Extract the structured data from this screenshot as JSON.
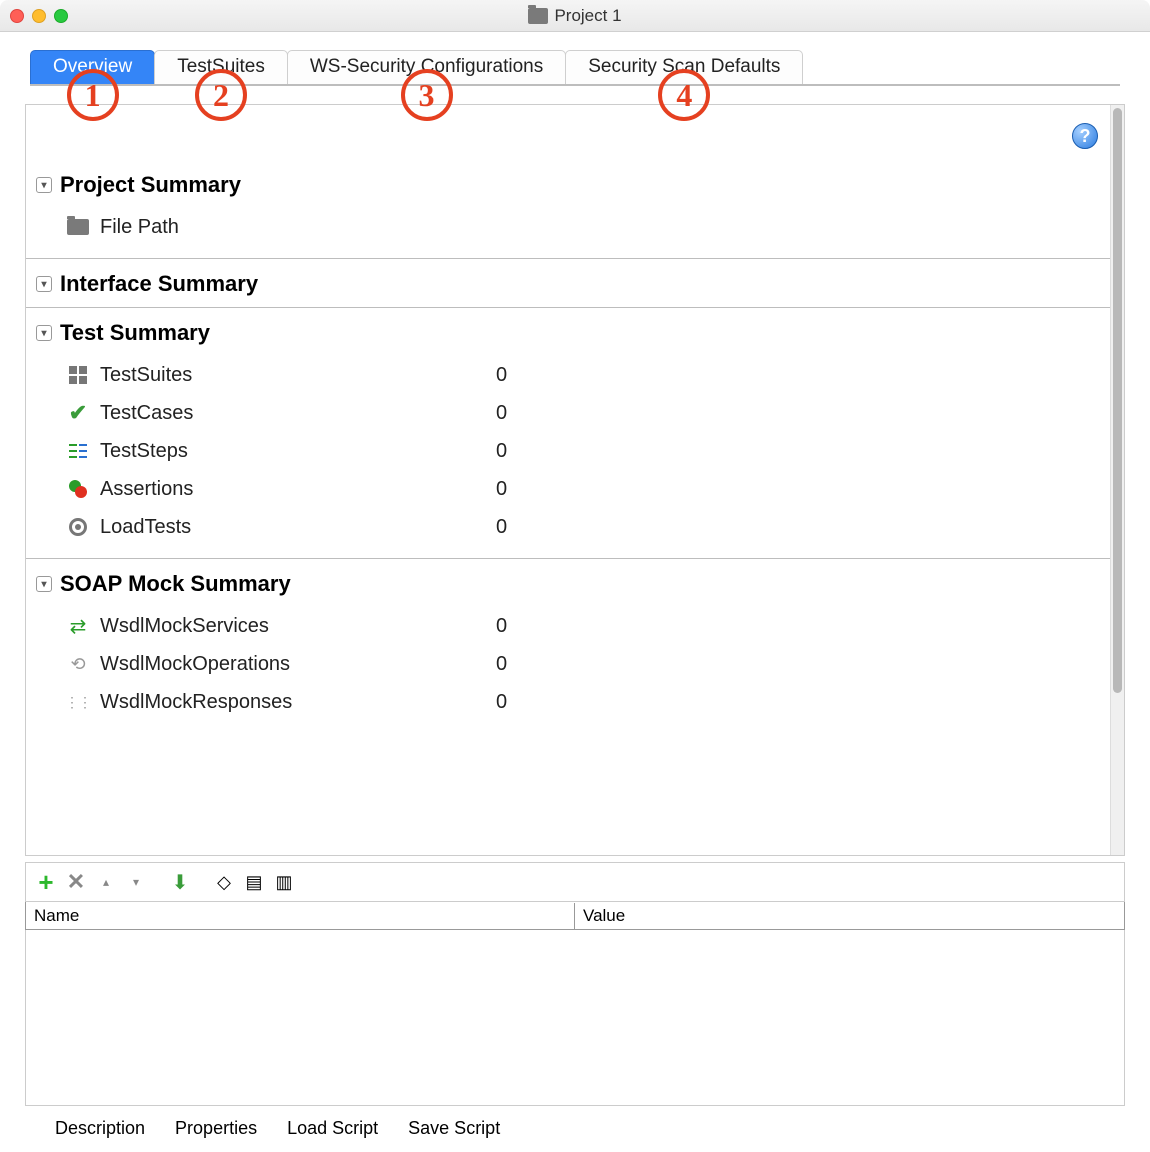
{
  "window": {
    "title": "Project 1"
  },
  "tabs": [
    {
      "label": "Overview",
      "active": true,
      "callout": "1"
    },
    {
      "label": "TestSuites",
      "active": false,
      "callout": "2"
    },
    {
      "label": "WS-Security Configurations",
      "active": false,
      "callout": "3"
    },
    {
      "label": "Security Scan Defaults",
      "active": false,
      "callout": "4"
    }
  ],
  "sections": {
    "project": {
      "title": "Project Summary",
      "items": [
        {
          "icon": "folder",
          "label": "File Path"
        }
      ]
    },
    "interface": {
      "title": "Interface Summary",
      "items": []
    },
    "test": {
      "title": "Test Summary",
      "items": [
        {
          "icon": "grid",
          "label": "TestSuites",
          "value": "0"
        },
        {
          "icon": "check",
          "label": "TestCases",
          "value": "0"
        },
        {
          "icon": "steps",
          "label": "TestSteps",
          "value": "0"
        },
        {
          "icon": "assert",
          "label": "Assertions",
          "value": "0"
        },
        {
          "icon": "load",
          "label": "LoadTests",
          "value": "0"
        }
      ]
    },
    "soap": {
      "title": "SOAP Mock Summary",
      "items": [
        {
          "icon": "swap",
          "label": "WsdlMockServices",
          "value": "0"
        },
        {
          "icon": "cycle",
          "label": "WsdlMockOperations",
          "value": "0"
        },
        {
          "icon": "dots",
          "label": "WsdlMockResponses",
          "value": "0"
        }
      ]
    }
  },
  "properties_table": {
    "columns": [
      "Name",
      "Value"
    ],
    "rows": []
  },
  "bottom_tabs": [
    "Description",
    "Properties",
    "Load Script",
    "Save Script"
  ],
  "help_tooltip": "?"
}
